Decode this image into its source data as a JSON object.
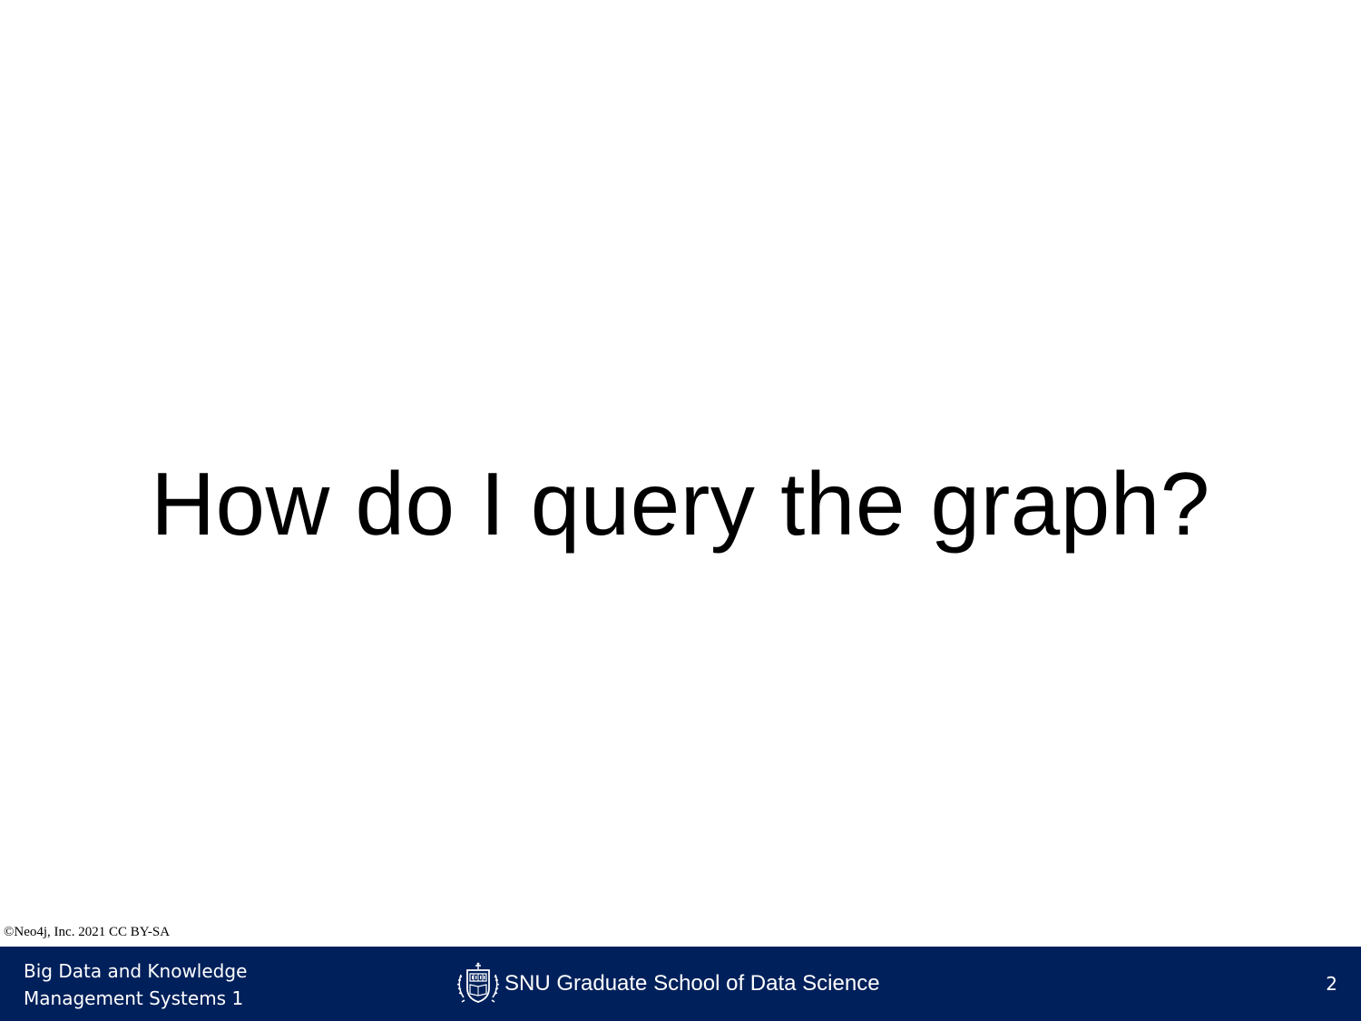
{
  "slide": {
    "title": "How do I query the graph?",
    "copyright": "©Neo4j, Inc. 2021 CC BY-SA",
    "page_number": "2"
  },
  "footer": {
    "course_line1": "Big Data and Knowledge",
    "course_line2": "Management Systems 1",
    "school_name": "SNU Graduate School of Data Science",
    "logo_icon": "university-seal-icon",
    "background_color": "#00205b",
    "text_color": "#ffffff"
  }
}
